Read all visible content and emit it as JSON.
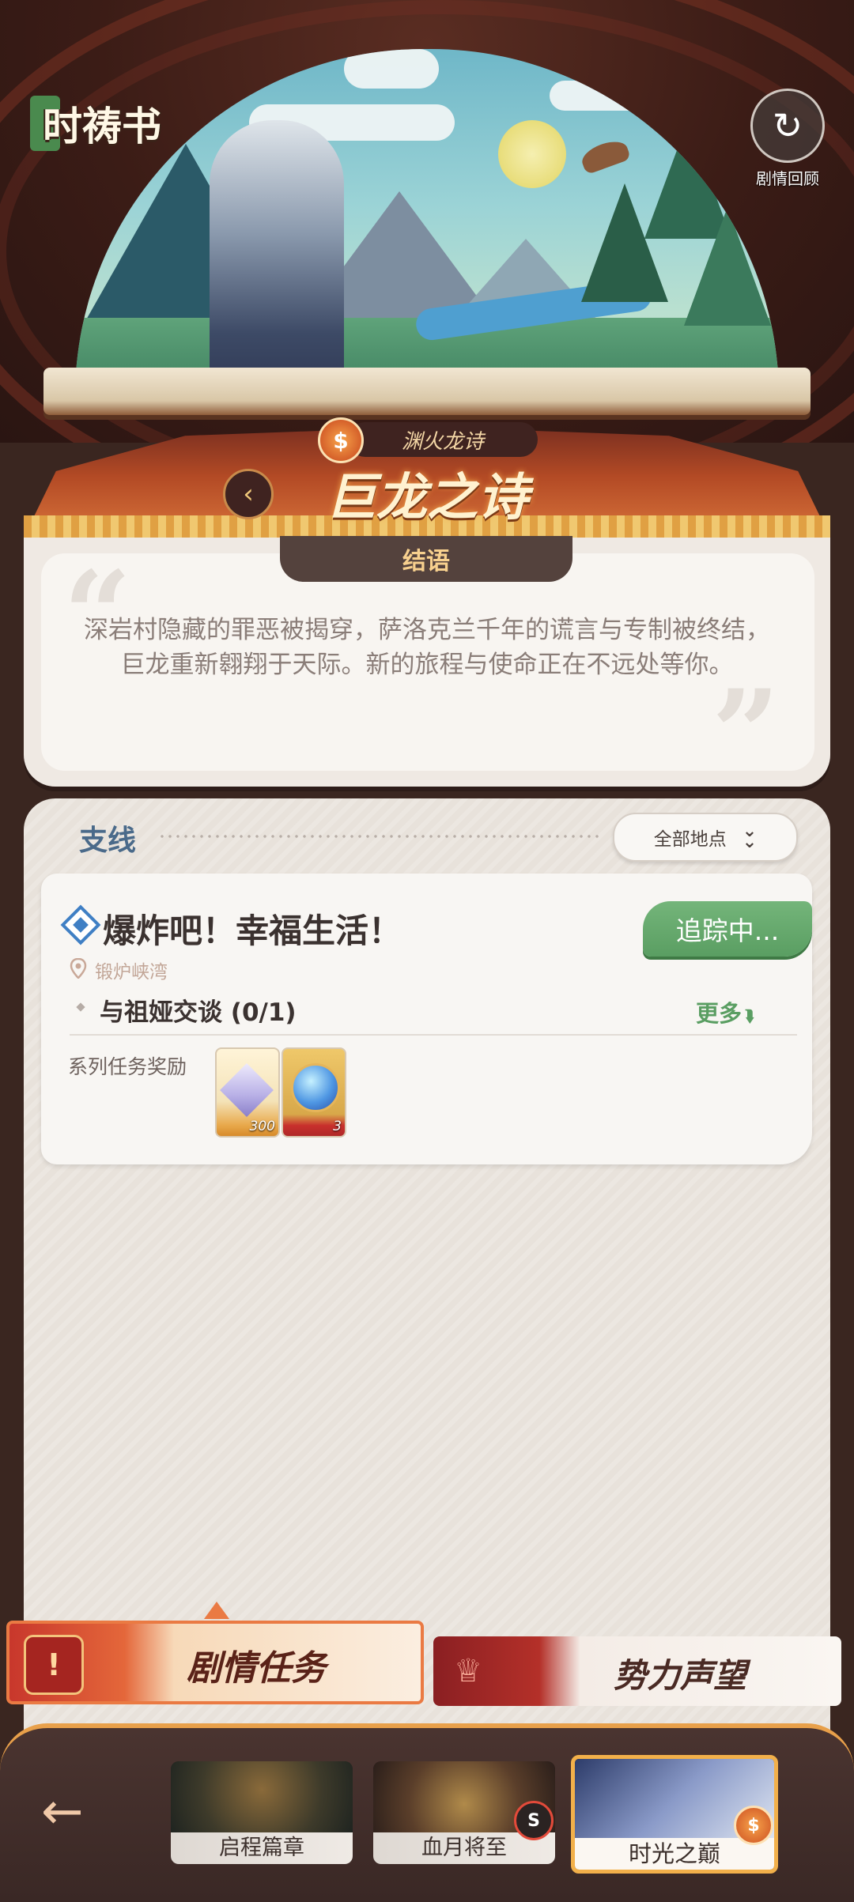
{
  "app": {
    "logo_text": "时祷书",
    "replay_label": "剧情回顾"
  },
  "chapter": {
    "subtitle": "渊火龙诗",
    "title": "巨龙之诗"
  },
  "ending": {
    "tab_label": "结语",
    "text": "深岩村隐藏的罪恶被揭穿，萨洛克兰千年的谎言与专制被终结，巨龙重新翱翔于天际。新的旅程与使命正在不远处等你。"
  },
  "side_quests": {
    "section_title": "支线",
    "filter_label": "全部地点",
    "quests": [
      {
        "title": "爆炸吧！幸福生活！",
        "status": "追踪中...",
        "location": "锻炉峡湾",
        "objective": "与祖娅交谈 (0/1)",
        "more_label": "更多",
        "reward_label": "系列任务奖励",
        "rewards": [
          {
            "icon": "crystal-gem",
            "quantity": "300"
          },
          {
            "icon": "blue-orb",
            "quantity": "3"
          }
        ]
      }
    ]
  },
  "tabs": {
    "story": "剧情任务",
    "faction": "势力声望"
  },
  "chapters_nav": [
    {
      "label": "启程篇章",
      "selected": false
    },
    {
      "label": "血月将至",
      "selected": false
    },
    {
      "label": "时光之巅",
      "selected": true
    }
  ],
  "colors": {
    "accent_orange": "#ea7a43",
    "tracking_green": "#5a9e62",
    "quest_diamond_blue": "#3f7fc4",
    "title_blue": "#4a6a8a"
  }
}
